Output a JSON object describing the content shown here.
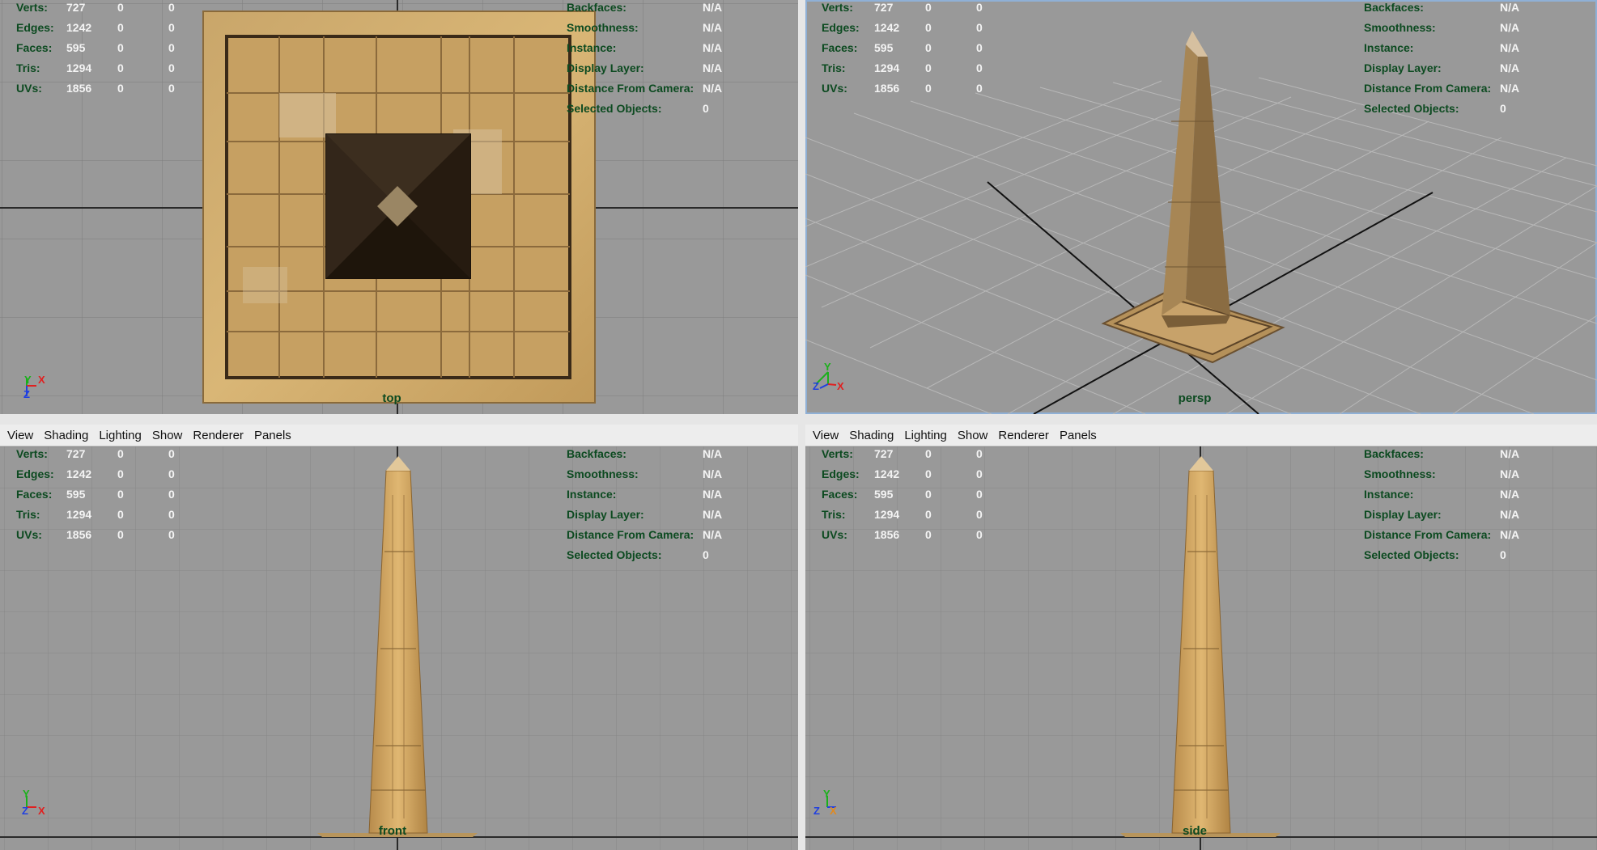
{
  "menu": [
    "View",
    "Shading",
    "Lighting",
    "Show",
    "Renderer",
    "Panels"
  ],
  "stats_left": {
    "rows": [
      {
        "label": "Verts:",
        "values": [
          "727",
          "0",
          "0"
        ]
      },
      {
        "label": "Edges:",
        "values": [
          "1242",
          "0",
          "0"
        ]
      },
      {
        "label": "Faces:",
        "values": [
          "595",
          "0",
          "0"
        ]
      },
      {
        "label": "Tris:",
        "values": [
          "1294",
          "0",
          "0"
        ]
      },
      {
        "label": "UVs:",
        "values": [
          "1856",
          "0",
          "0"
        ]
      }
    ]
  },
  "stats_right": {
    "rows": [
      {
        "label": "Backfaces:",
        "value": "N/A"
      },
      {
        "label": "Smoothness:",
        "value": "N/A"
      },
      {
        "label": "Instance:",
        "value": "N/A"
      },
      {
        "label": "Display Layer:",
        "value": "N/A"
      },
      {
        "label": "Distance From Camera:",
        "value": "N/A"
      },
      {
        "label": "Selected Objects:",
        "value": "0"
      }
    ]
  },
  "viewports": {
    "top": {
      "camera": "top",
      "axes": [
        "Y",
        "X",
        "Z"
      ]
    },
    "persp": {
      "camera": "persp",
      "axes": [
        "Y",
        "Z",
        "X"
      ]
    },
    "front": {
      "camera": "front",
      "axes": [
        "Y",
        "Z",
        "X"
      ]
    },
    "side": {
      "camera": "side",
      "axes": [
        "Y",
        "Z",
        "X"
      ]
    }
  },
  "colors": {
    "viewport_bg": "#999999",
    "hud_label": "#0c4a20",
    "hud_value": "#f4f4f4",
    "active_border": "#8fb0d6",
    "stone": "#c9a060"
  }
}
